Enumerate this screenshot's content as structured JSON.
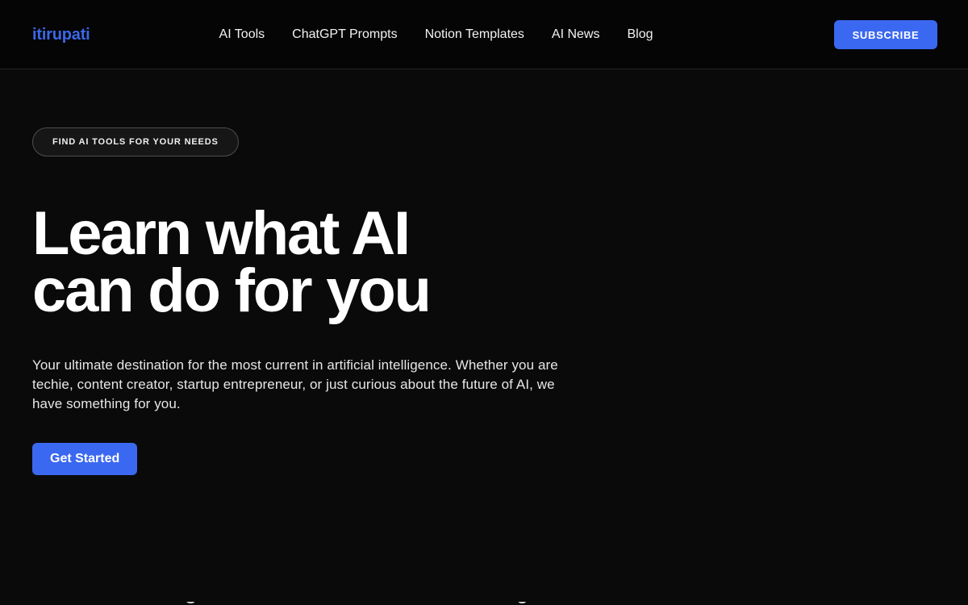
{
  "header": {
    "brand": "itirupati",
    "nav": [
      {
        "label": "AI Tools"
      },
      {
        "label": "ChatGPT Prompts"
      },
      {
        "label": "Notion Templates"
      },
      {
        "label": "AI News"
      },
      {
        "label": "Blog"
      }
    ],
    "subscribe_label": "SUBSCRIBE"
  },
  "hero": {
    "eyebrow": "FIND AI TOOLS FOR YOUR NEEDS",
    "title_line1": "Learn what AI",
    "title_line2": "can do for you",
    "subtitle": "Your ultimate destination for the most current in artificial intelligence. Whether you are techie, content creator, startup entrepreneur, or just curious about the future of AI, we have something for you.",
    "cta_label": "Get Started"
  },
  "below_fold": {
    "peek_left": "S",
    "peek_right": "C"
  },
  "colors": {
    "page_background": "#0a0a0a",
    "header_background": "#050505",
    "header_divider": "#242424",
    "brand_blue": "#3b68e8",
    "accent_blue": "#3b68f0",
    "text_primary": "#ffffff",
    "text_secondary": "#e6e6e6",
    "pill_border": "#4e4e4e",
    "pill_background": "#161616"
  }
}
